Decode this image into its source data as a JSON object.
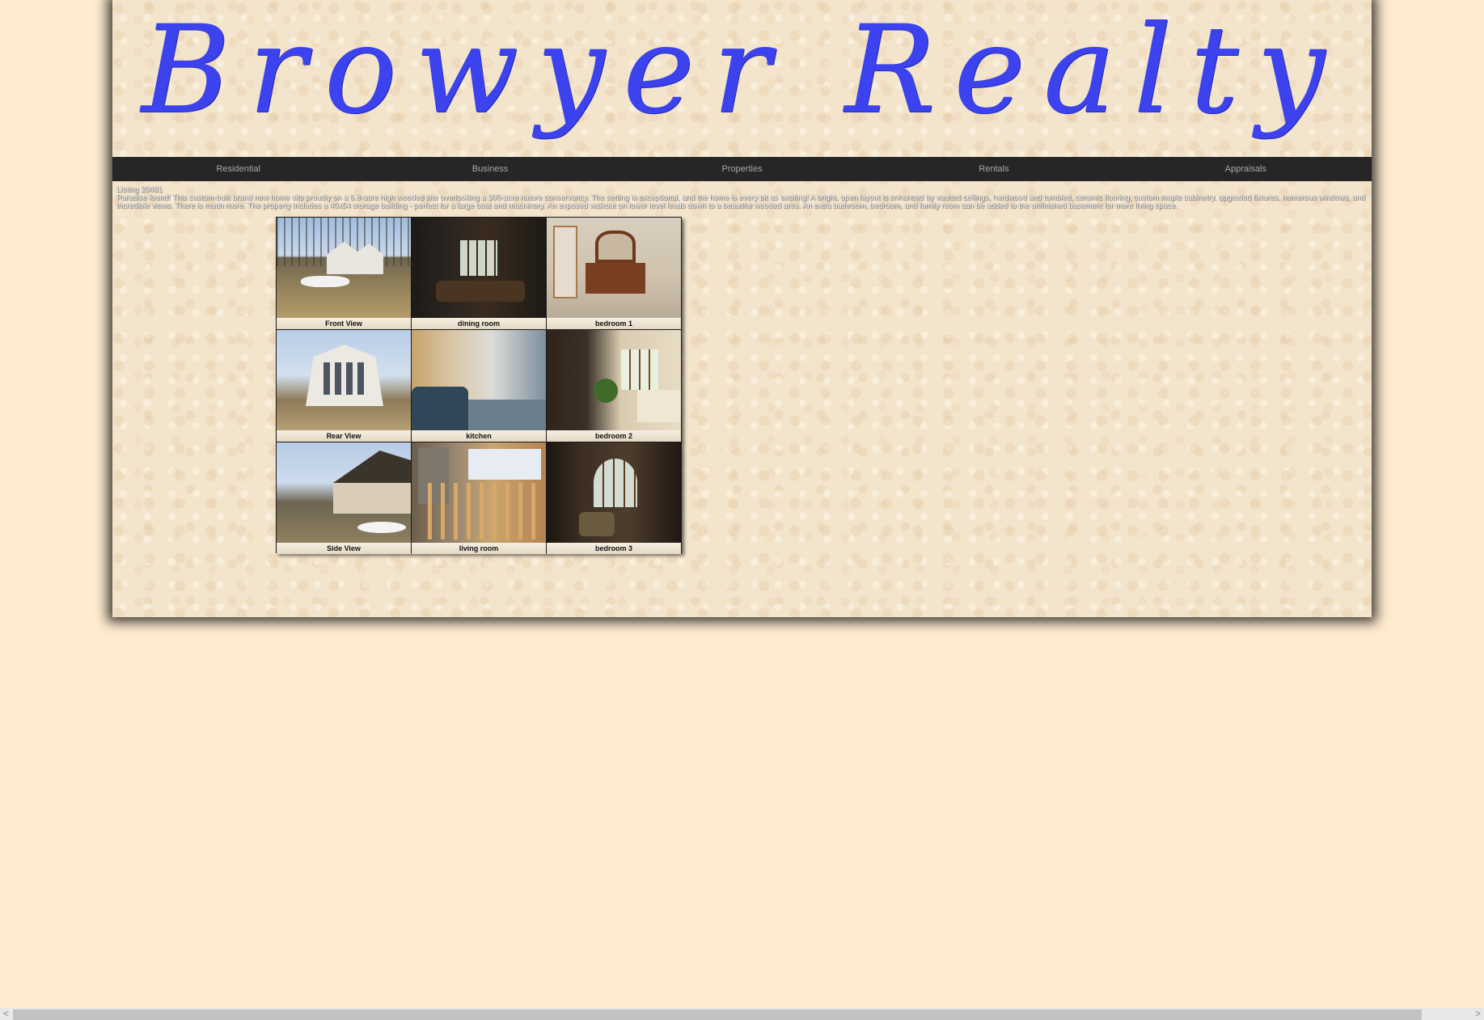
{
  "header": {
    "logo_text": "Browyer Realty"
  },
  "nav": {
    "items": [
      {
        "label": "Residential"
      },
      {
        "label": "Business"
      },
      {
        "label": "Properties"
      },
      {
        "label": "Rentals"
      },
      {
        "label": "Appraisals"
      }
    ]
  },
  "listing": {
    "id_label": "Listing 20481",
    "description": "Paradise found! This custom-built brand new home sits proudly on a 6.8-acre high wooded site overlooking a 300-acre nature conservancy. The setting is exceptional, and the home is every bit as exciting! A bright, open layout is enhanced by vaulted ceilings, hardwood and tumbled, ceramic flooring, custom maple cabinetry, upgraded fixtures, numerous windows, and incredible views. There is much more. The property includes a 40x54 storage building - perfect for a large boat and machinery. An exposed walkout on lower level leads down to a beautiful wooded area. An extra bathroom, bedroom, and family room can be added to the unfinished basement for more living space."
  },
  "gallery": {
    "photos": [
      {
        "caption": "Front View"
      },
      {
        "caption": "dining room"
      },
      {
        "caption": "bedroom 1"
      },
      {
        "caption": "Rear View"
      },
      {
        "caption": "kitchen"
      },
      {
        "caption": "bedroom 2"
      },
      {
        "caption": "Side View"
      },
      {
        "caption": "living room"
      },
      {
        "caption": "bedroom 3"
      }
    ]
  },
  "scrollbar": {
    "left_arrow": "<",
    "right_arrow": ">"
  },
  "colors": {
    "logo": "#3c43ee",
    "nav_bg": "#262626",
    "nav_text": "#a8a8a8",
    "body_bg": "#ffeccf"
  }
}
